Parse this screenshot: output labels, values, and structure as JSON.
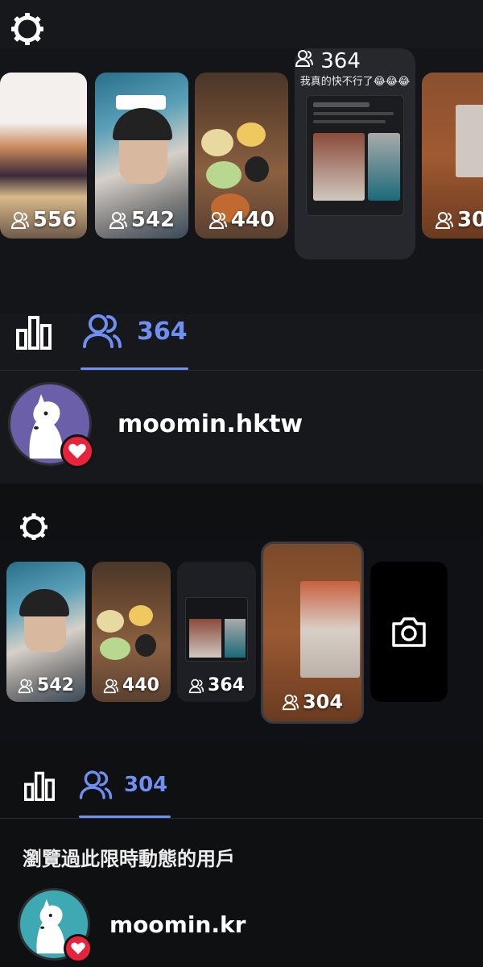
{
  "top": {
    "thumbnails": [
      {
        "count": "556"
      },
      {
        "count": "542"
      },
      {
        "count": "440"
      },
      {
        "count": "364",
        "caption": "我真的快不行了😂😂😂"
      },
      {
        "count": "30"
      }
    ],
    "stats_tab_icon": "bar-chart-icon",
    "viewers_tab": {
      "icon": "viewers-icon",
      "count": "364"
    },
    "viewer": {
      "username": "moomin.hktw",
      "badge": "heart-icon"
    }
  },
  "bottom": {
    "thumbnails": [
      {
        "count": "542"
      },
      {
        "count": "440"
      },
      {
        "count": "364"
      },
      {
        "count": "304"
      }
    ],
    "camera_tile_icon": "camera-icon",
    "viewers_tab": {
      "icon": "viewers-icon",
      "count": "304"
    },
    "section_title": "瀏覽過此限時動態的用戶",
    "viewer": {
      "username": "moomin.kr",
      "badge": "heart-icon"
    }
  },
  "colors": {
    "accent": "#6f8ff2",
    "heart": "#e8243c",
    "background": "#16181c"
  }
}
